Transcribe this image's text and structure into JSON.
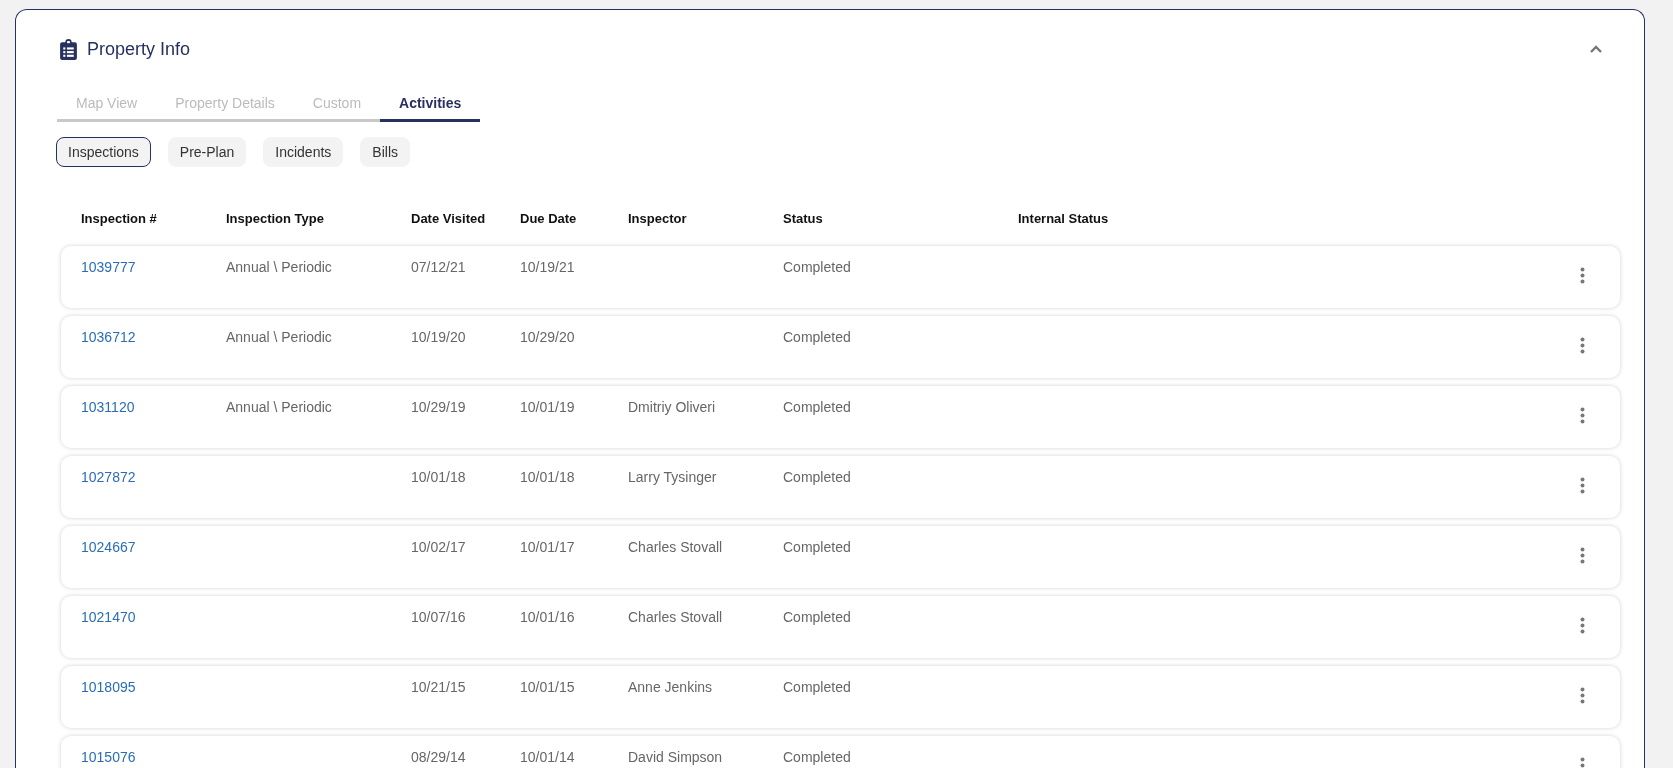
{
  "panel": {
    "title": "Property Info",
    "expanded": true
  },
  "tabs": [
    {
      "label": "Map View",
      "selected": false
    },
    {
      "label": "Property Details",
      "selected": false
    },
    {
      "label": "Custom",
      "selected": false
    },
    {
      "label": "Activities",
      "selected": true
    }
  ],
  "subtabs": [
    {
      "label": "Inspections",
      "selected": true
    },
    {
      "label": "Pre-Plan",
      "selected": false
    },
    {
      "label": "Incidents",
      "selected": false
    },
    {
      "label": "Bills",
      "selected": false
    }
  ],
  "table": {
    "columns": [
      "Inspection #",
      "Inspection Type",
      "Date Visited",
      "Due Date",
      "Inspector",
      "Status",
      "Internal Status"
    ],
    "rows": [
      {
        "inspection_no": "1039777",
        "inspection_type": "Annual \\ Periodic",
        "date_visited": "07/12/21",
        "due_date": "10/19/21",
        "status": "Completed"
      },
      {
        "inspection_no": "1036712",
        "inspection_type": "Annual \\ Periodic",
        "date_visited": "10/19/20",
        "due_date": "10/29/20",
        "status": "Completed"
      },
      {
        "inspection_no": "1031120",
        "inspection_type": "Annual \\ Periodic",
        "date_visited": "10/29/19",
        "due_date": "10/01/19",
        "inspector": "Dmitriy Oliveri",
        "status": "Completed"
      },
      {
        "inspection_no": "1027872",
        "date_visited": "10/01/18",
        "due_date": "10/01/18",
        "inspector": "Larry Tysinger",
        "status": "Completed"
      },
      {
        "inspection_no": "1024667",
        "date_visited": "10/02/17",
        "due_date": "10/01/17",
        "inspector": "Charles Stovall",
        "status": "Completed"
      },
      {
        "inspection_no": "1021470",
        "date_visited": "10/07/16",
        "due_date": "10/01/16",
        "inspector": "Charles Stovall",
        "status": "Completed"
      },
      {
        "inspection_no": "1018095",
        "date_visited": "10/21/15",
        "due_date": "10/01/15",
        "inspector": "Anne Jenkins",
        "status": "Completed"
      },
      {
        "inspection_no": "1015076",
        "date_visited": "08/29/14",
        "due_date": "10/01/14",
        "inspector": "David Simpson",
        "status": "Completed"
      }
    ]
  }
}
